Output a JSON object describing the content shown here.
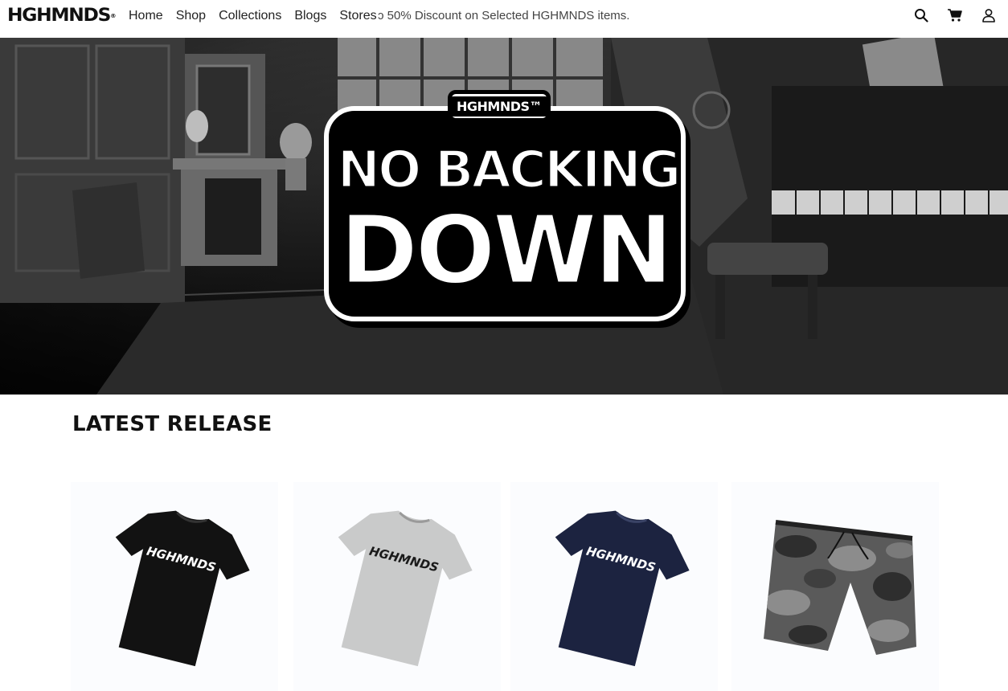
{
  "header": {
    "logo": "HGHMNDS",
    "logo_mark": "®",
    "nav": [
      "Home",
      "Shop",
      "Collections",
      "Blogs",
      "Stores"
    ],
    "announcement": "ɔ 50% Discount on Selected HGHMNDS items.",
    "icons": [
      "search-icon",
      "cart-icon",
      "account-icon"
    ]
  },
  "hero": {
    "badge_tag": "HGHMNDS™",
    "line1": "NO BACKING",
    "line2": "DOWN"
  },
  "latest": {
    "title": "LATEST RELEASE",
    "products": [
      {
        "name": "black-tee",
        "print": "HGHMNDS",
        "color": "#121212",
        "print_color": "#ffffff"
      },
      {
        "name": "grey-tee",
        "print": "HGHMNDS",
        "color": "#c9caca",
        "print_color": "#1a1a1a"
      },
      {
        "name": "navy-tee",
        "print": "HGHMNDS",
        "color": "#1c2340",
        "print_color": "#ffffff"
      },
      {
        "name": "camo-shorts",
        "print": "",
        "color": "#5a5a5a",
        "print_color": ""
      }
    ]
  }
}
